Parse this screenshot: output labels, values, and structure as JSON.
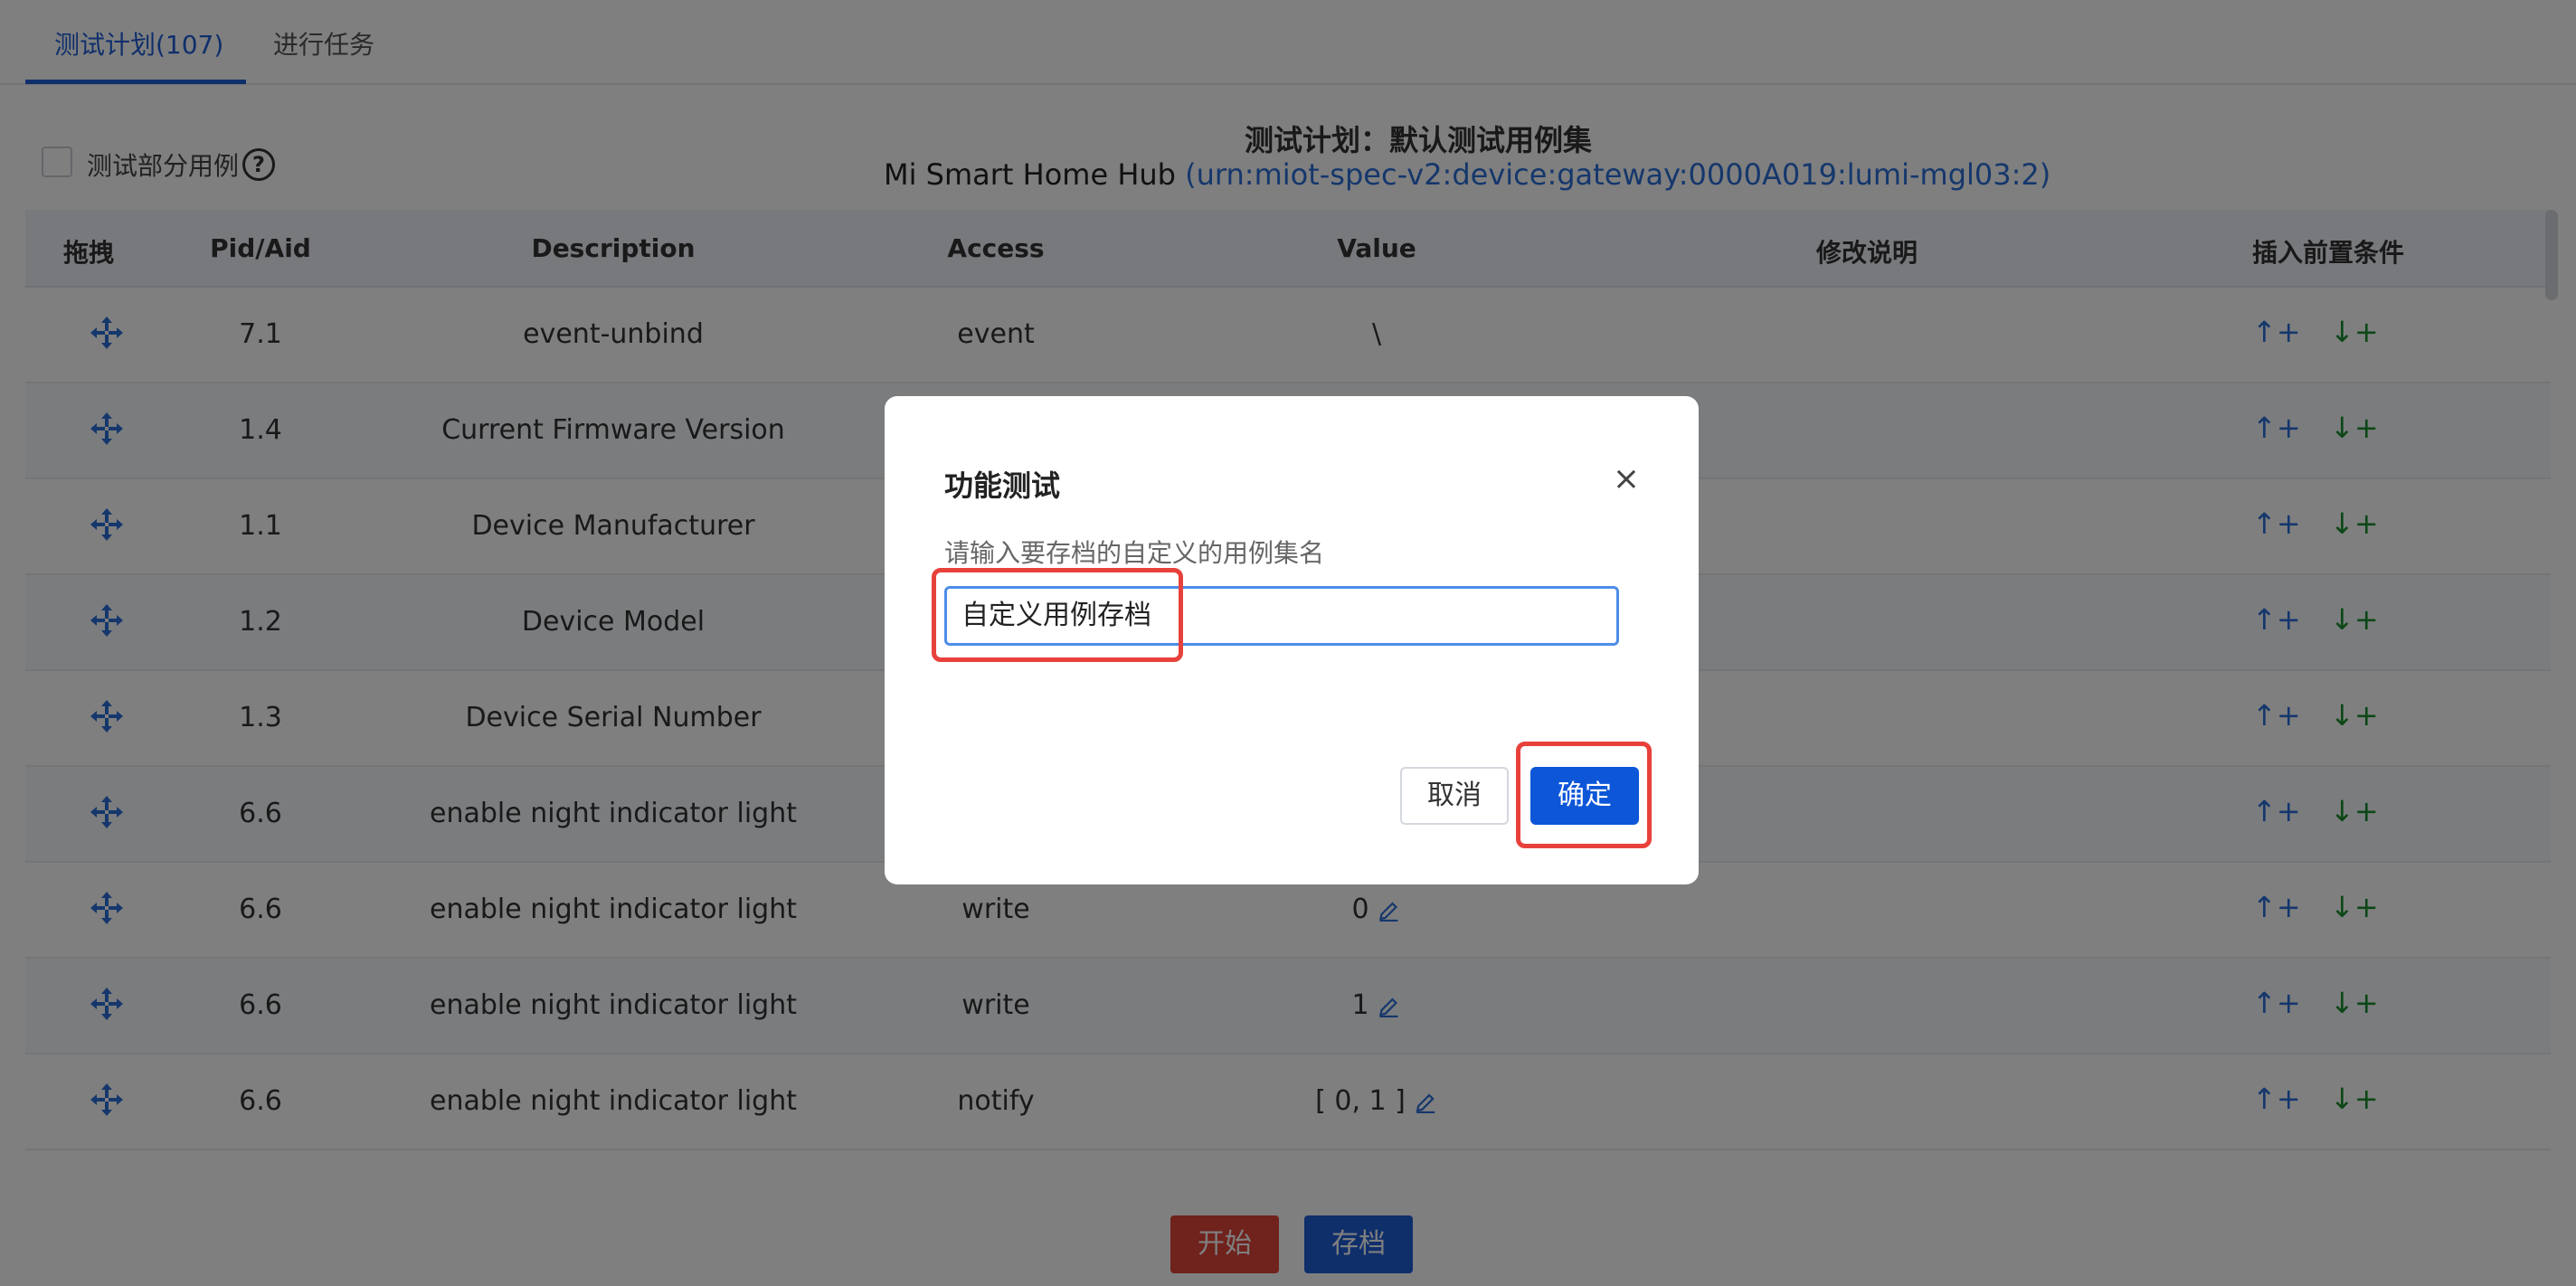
{
  "tabs": [
    {
      "label": "测试计划(107)",
      "active": true
    },
    {
      "label": "进行任务",
      "active": false
    }
  ],
  "header": {
    "partial_label": "测试部分用例",
    "help_icon": "question-circle-icon",
    "plan_title": "测试计划：默认测试用例集",
    "device_name": "Mi Smart Home Hub",
    "device_urn": "(urn:miot-spec-v2:device:gateway:0000A019:lumi-mgl03:2)"
  },
  "table": {
    "columns": [
      "拖拽",
      "Pid/Aid",
      "Description",
      "Access",
      "Value",
      "修改说明",
      "插入前置条件"
    ],
    "rows": [
      {
        "pid": "7.1",
        "desc": "event-unbind",
        "access": "event",
        "value": "\\",
        "editable": false
      },
      {
        "pid": "1.4",
        "desc": "Current Firmware Version",
        "access": "",
        "value": "",
        "editable": false
      },
      {
        "pid": "1.1",
        "desc": "Device Manufacturer",
        "access": "",
        "value": "",
        "editable": false
      },
      {
        "pid": "1.2",
        "desc": "Device Model",
        "access": "",
        "value": "",
        "editable": false
      },
      {
        "pid": "1.3",
        "desc": "Device Serial Number",
        "access": "",
        "value": "",
        "editable": false
      },
      {
        "pid": "6.6",
        "desc": "enable night indicator light",
        "access": "",
        "value": "",
        "editable": false
      },
      {
        "pid": "6.6",
        "desc": "enable night indicator light",
        "access": "write",
        "value": "0",
        "editable": true
      },
      {
        "pid": "6.6",
        "desc": "enable night indicator light",
        "access": "write",
        "value": "1",
        "editable": true
      },
      {
        "pid": "6.6",
        "desc": "enable night indicator light",
        "access": "notify",
        "value": "[ 0, 1 ]",
        "editable": true
      }
    ],
    "insert_up": "↑+",
    "insert_down": "↓+"
  },
  "footer": {
    "start_label": "开始",
    "archive_label": "存档"
  },
  "dialog": {
    "title": "功能测试",
    "close": "×",
    "label": "请输入要存档的自定义的用例集名",
    "input_value": "自定义用例存档",
    "cancel_label": "取消",
    "confirm_label": "确定"
  },
  "colors": {
    "accent": "#1f5fd6",
    "highlight": "#e8413b",
    "insert_up": "#2b6fd8",
    "insert_down": "#1a8f2e"
  }
}
